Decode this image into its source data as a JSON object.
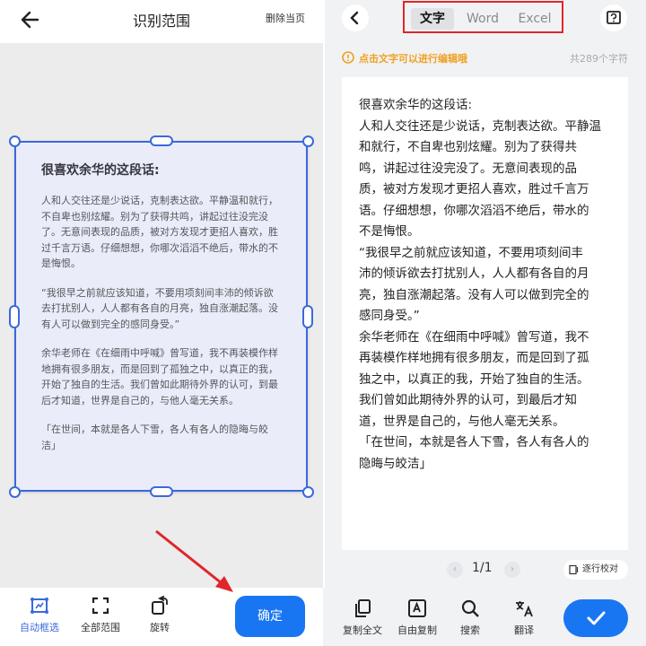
{
  "left": {
    "title": "识别范围",
    "delete_label": "删除当页",
    "document": {
      "title": "很喜欢余华的这段话:",
      "paragraphs": [
        "人和人交往还是少说话，克制表达欲。平静温和就行，不自卑也别炫耀。别为了获得共鸣，讲起过往没完没了。无意间表现的品质，被对方发现才更招人喜欢，胜过千言万语。仔细想想，你哪次滔滔不绝后，带水的不是悔恨。",
        "“我很早之前就应该知道，不要用项刻间丰沛的倾诉欲去打扰别人，人人都有各自的月亮，独自涨潮起落。没有人可以做到完全的感同身受。”",
        "余华老师在《在细雨中呼喊》曾写道，我不再装模作样地拥有很多朋友，而是回到了孤独之中，以真正的我，开始了独自的生活。我们曾如此期待外界的认可，到最后才知道，世界是自己的，与他人毫无关系。",
        "「在世间，本就是各人下雪，各人有各人的隐晦与皎洁」"
      ]
    },
    "toolbar": {
      "auto_select": "自动框选",
      "full_range": "全部范围",
      "rotate": "旋转",
      "confirm": "确定"
    }
  },
  "right": {
    "tabs": [
      "文字",
      "Word",
      "Excel"
    ],
    "active_tab": "文字",
    "hint": "点击文字可以进行编辑哦",
    "char_count": "共289个字符",
    "lines": [
      "很喜欢余华的这段话:",
      "人和人交往还是少说话，克制表达欲。平静温",
      "和就行，不自卑也别炫耀。别为了获得共",
      "鸣，讲起过往没完没了。无意间表现的品",
      "质，被对方发现才更招人喜欢，胜过千言万",
      "语。仔细想想，你哪次滔滔不绝后，带水的",
      "不是悔恨。",
      "“我很早之前就应该知道，不要用项刻间丰",
      "沛的倾诉欲去打扰别人，人人都有各自的月",
      "亮，独自涨潮起落。没有人可以做到完全的",
      "感同身受。”",
      "余华老师在《在细雨中呼喊》曾写道，我不",
      "再装模作样地拥有很多朋友，而是回到了孤",
      "独之中，以真正的我，开始了独自的生活。",
      "我们曾如此期待外界的认可，到最后才知",
      "道，世界是自己的，与他人毫无关系。",
      "「在世间，本就是各人下雪，各人有各人的",
      "隐晦与皎洁」"
    ],
    "pager": "1/1",
    "verify_label": "逐行校对",
    "toolbar": {
      "copy_all": "复制全文",
      "free_copy": "自由复制",
      "search": "搜索",
      "translate": "翻译"
    }
  },
  "colors": {
    "accent": "#1976f2",
    "selection": "#3a69de",
    "hint": "#f0a020",
    "highlight_box": "#e0262a",
    "arrow": "#e0262a"
  },
  "icons": [
    "back-arrow-icon",
    "chevron-left-icon",
    "help-icon",
    "warning-icon",
    "auto-select-icon",
    "full-range-icon",
    "rotate-icon",
    "copy-icon",
    "free-copy-icon",
    "search-icon",
    "translate-icon",
    "checkmark-icon",
    "verify-icon"
  ]
}
